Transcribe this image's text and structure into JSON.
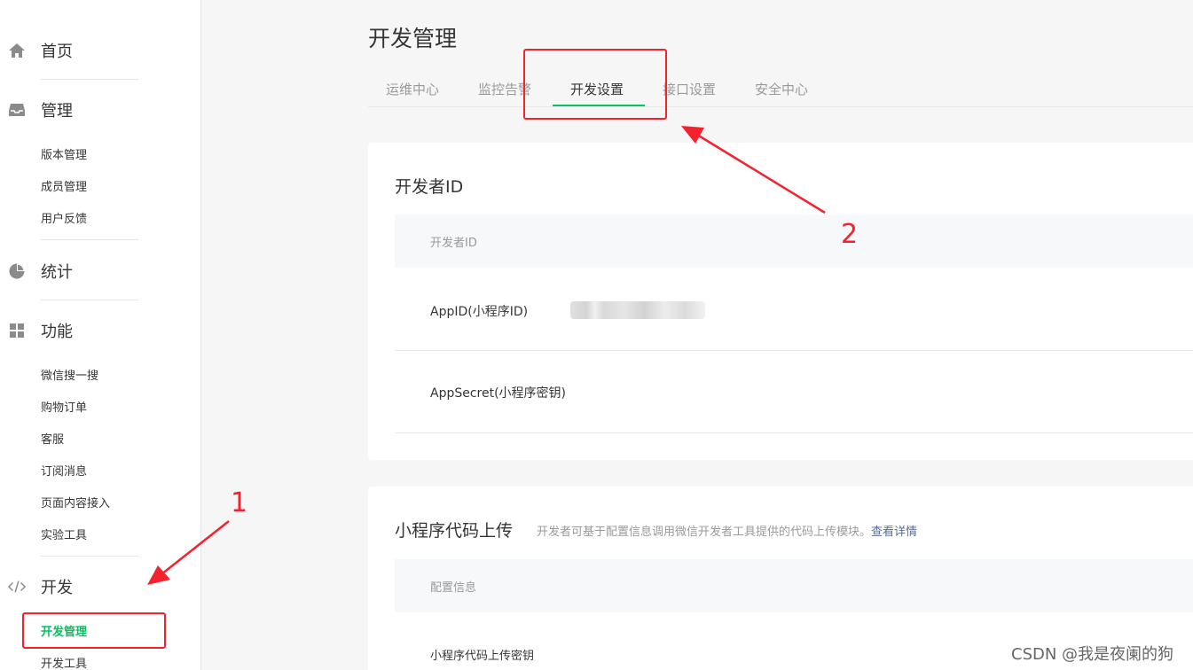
{
  "sidebar": {
    "home": {
      "label": "首页",
      "icon": "home-icon"
    },
    "manage": {
      "label": "管理",
      "icon": "inbox-icon",
      "items": [
        "版本管理",
        "成员管理",
        "用户反馈"
      ]
    },
    "stats": {
      "label": "统计",
      "icon": "pie-chart-icon"
    },
    "features": {
      "label": "功能",
      "icon": "grid-icon",
      "items": [
        "微信搜一搜",
        "购物订单",
        "客服",
        "订阅消息",
        "页面内容接入",
        "实验工具"
      ]
    },
    "develop": {
      "label": "开发",
      "icon": "code-icon",
      "items": [
        "开发管理",
        "开发工具"
      ]
    }
  },
  "page_title": "开发管理",
  "tabs": [
    "运维中心",
    "监控告警",
    "开发设置",
    "接口设置",
    "安全中心"
  ],
  "active_tab": "开发设置",
  "developer_id_card": {
    "title": "开发者ID",
    "table_header": "开发者ID",
    "rows": [
      "AppID(小程序ID)",
      "AppSecret(小程序密钥)"
    ]
  },
  "upload_card": {
    "title": "小程序代码上传",
    "description": "开发者可基于配置信息调用微信开发者工具提供的代码上传模块。",
    "link": "查看详情",
    "table_header": "配置信息",
    "rows": [
      "小程序代码上传密钥"
    ]
  },
  "annotations": {
    "first": "1",
    "second": "2"
  },
  "watermark": "CSDN @我是夜阑的狗",
  "colors": {
    "accent": "#07c160",
    "annotation": "#f5222d",
    "link": "#576b95"
  }
}
